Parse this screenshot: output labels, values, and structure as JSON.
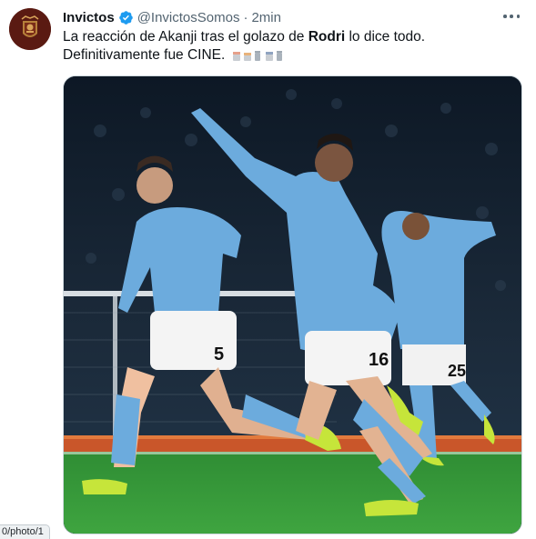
{
  "tweet": {
    "author_name": "Invictos",
    "handle": "@InvictosSomos",
    "separator": "·",
    "time": "2min",
    "text_before": "La reacción de Akanji tras el golazo de ",
    "text_bold": "Rodri",
    "text_after": " lo dice todo. Definitivamente fue CINE.",
    "verified": true
  },
  "media": {
    "description_icon": "photo",
    "jersey_numbers": [
      "5",
      "16",
      "25"
    ]
  },
  "status_bar": {
    "url": "0/photo/1"
  },
  "colors": {
    "verified_blue": "#1d9bf0",
    "avatar_bg": "#5a1a12",
    "jersey_sky_blue": "#6cabdd",
    "pitch_green": "#3a9a3a"
  }
}
